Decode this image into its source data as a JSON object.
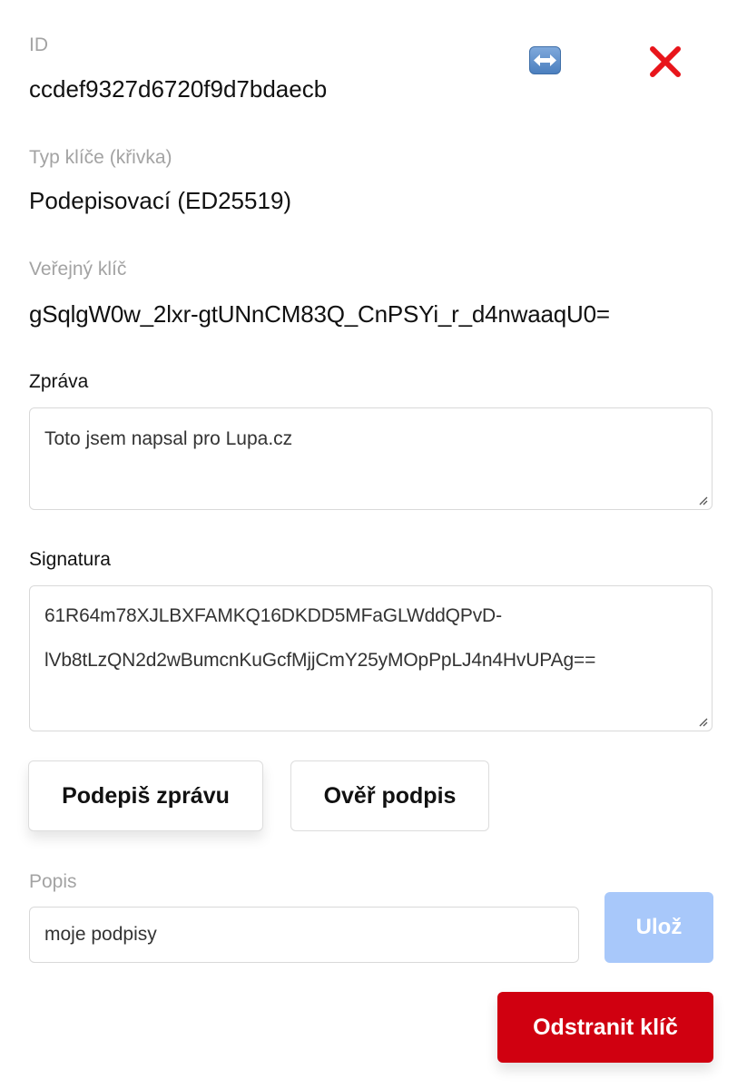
{
  "key": {
    "id_label": "ID",
    "id_value": "ccdef9327d6720f9d7bdaecb",
    "type_label": "Typ klíče (křivka)",
    "type_value": "Podepisovací (ED25519)",
    "public_key_label": "Veřejný klíč",
    "public_key_value": "gSqlgW0w_2lxr-gtUNnCM83Q_CnPSYi_r_d4nwaaqU0="
  },
  "icons": {
    "swap": "left-right-arrow-icon",
    "close": "close-x-icon"
  },
  "message": {
    "label": "Zpráva",
    "value": "Toto jsem napsal pro Lupa.cz"
  },
  "signature": {
    "label": "Signatura",
    "line1": "61R64m78XJLBXFAMKQ16DKDD5MFaGLWddQPvD-",
    "line2": "lVb8tLzQN2d2wBumcnKuGcfMjjCmY25yMOpPpLJ4n4HvUPAg=="
  },
  "actions": {
    "sign_label": "Podepiš zprávu",
    "verify_label": "Ověř podpis"
  },
  "description": {
    "label": "Popis",
    "value": "moje podpisy",
    "save_label": "Ulož"
  },
  "delete_label": "Odstranit klíč",
  "colors": {
    "danger": "#d00010",
    "save_disabled": "#a8c8fa",
    "muted_text": "#a3a3a3"
  }
}
